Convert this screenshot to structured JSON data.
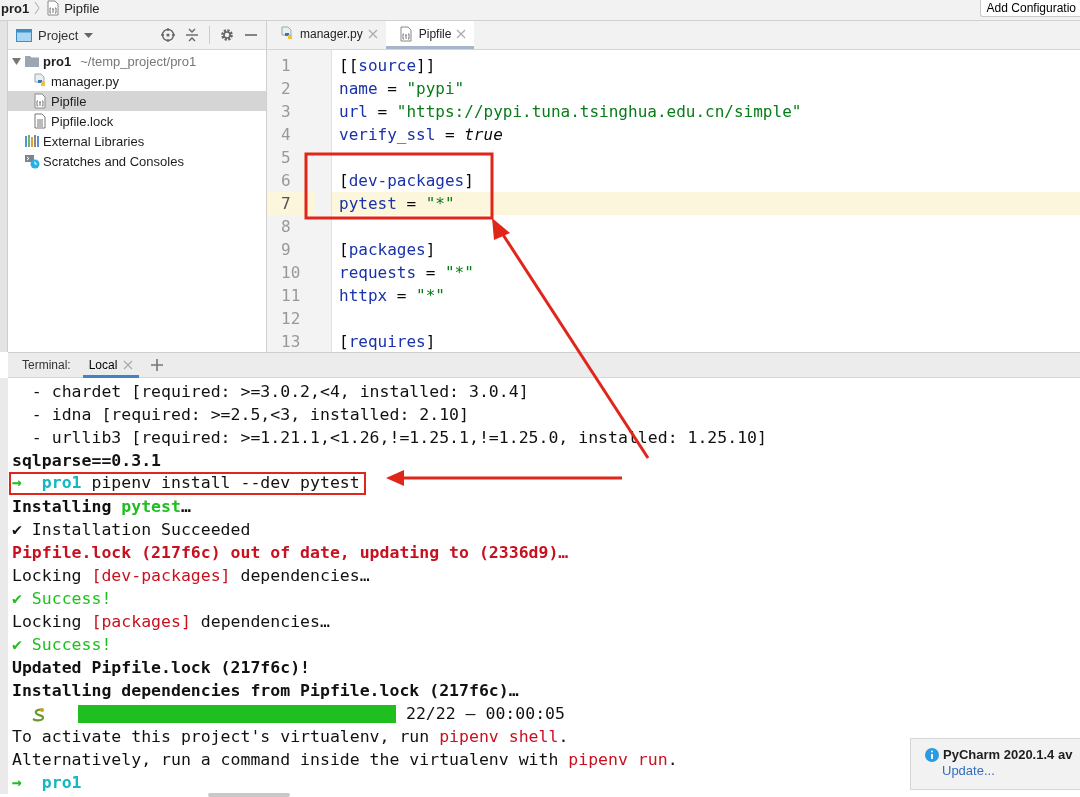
{
  "breadcrumb": [
    {
      "label": "pro1"
    },
    {
      "label": "Pipfile",
      "kind": "pipfile"
    }
  ],
  "run_config_button": "Add Configuratio",
  "project_panel": {
    "title": "Project",
    "tree": [
      {
        "label": "pro1",
        "path": "~/temp_project/pro1",
        "kind": "folder",
        "expanded": true,
        "selected": false,
        "children": [
          {
            "label": "manager.py",
            "kind": "python",
            "selected": false
          },
          {
            "label": "Pipfile",
            "kind": "pipfile",
            "selected": true
          },
          {
            "label": "Pipfile.lock",
            "kind": "text",
            "selected": false
          }
        ]
      },
      {
        "label": "External Libraries",
        "kind": "libraries",
        "selected": false
      },
      {
        "label": "Scratches and Consoles",
        "kind": "scratches",
        "selected": false
      }
    ]
  },
  "editor": {
    "tabs": [
      {
        "label": "manager.py",
        "kind": "python",
        "selected": false
      },
      {
        "label": "Pipfile",
        "kind": "pipfile",
        "selected": true
      }
    ],
    "lines": [
      {
        "number": "1",
        "current": false,
        "tokens": [
          {
            "text": "[[",
            "kind": "punct"
          },
          {
            "text": "source",
            "kind": "name"
          },
          {
            "text": "]]",
            "kind": "punct"
          }
        ]
      },
      {
        "number": "2",
        "current": false,
        "tokens": [
          {
            "text": "name",
            "kind": "name"
          },
          {
            "text": " = ",
            "kind": "punct"
          },
          {
            "text": "\"pypi\"",
            "kind": "string"
          }
        ]
      },
      {
        "number": "3",
        "current": false,
        "tokens": [
          {
            "text": "url",
            "kind": "name"
          },
          {
            "text": " = ",
            "kind": "punct"
          },
          {
            "text": "\"https://pypi.tuna.tsinghua.edu.cn/simple\"",
            "kind": "string"
          }
        ]
      },
      {
        "number": "4",
        "current": false,
        "tokens": [
          {
            "text": "verify_ssl",
            "kind": "name"
          },
          {
            "text": " = ",
            "kind": "punct"
          },
          {
            "text": "true",
            "kind": "keyword"
          }
        ]
      },
      {
        "number": "5",
        "current": false
      },
      {
        "number": "6",
        "current": false,
        "tokens": [
          {
            "text": "[",
            "kind": "punct"
          },
          {
            "text": "dev-packages",
            "kind": "name"
          },
          {
            "text": "]",
            "kind": "punct"
          }
        ]
      },
      {
        "number": "7",
        "current": true,
        "tokens": [
          {
            "text": "pytest",
            "kind": "name"
          },
          {
            "text": " = ",
            "kind": "punct"
          },
          {
            "text": "\"*\"",
            "kind": "string"
          }
        ]
      },
      {
        "number": "8",
        "current": false
      },
      {
        "number": "9",
        "current": false,
        "tokens": [
          {
            "text": "[",
            "kind": "punct"
          },
          {
            "text": "packages",
            "kind": "name"
          },
          {
            "text": "]",
            "kind": "punct"
          }
        ]
      },
      {
        "number": "10",
        "current": false,
        "tokens": [
          {
            "text": "requests",
            "kind": "name"
          },
          {
            "text": " = ",
            "kind": "punct"
          },
          {
            "text": "\"*\"",
            "kind": "string"
          }
        ]
      },
      {
        "number": "11",
        "current": false,
        "tokens": [
          {
            "text": "httpx",
            "kind": "name"
          },
          {
            "text": " = ",
            "kind": "punct"
          },
          {
            "text": "\"*\"",
            "kind": "string"
          }
        ]
      },
      {
        "number": "12",
        "current": false
      },
      {
        "number": "13",
        "current": false,
        "tokens": [
          {
            "text": "[",
            "kind": "punct"
          },
          {
            "text": "requires",
            "kind": "name"
          },
          {
            "text": "]",
            "kind": "punct"
          }
        ]
      }
    ]
  },
  "terminal": {
    "label": "Terminal:",
    "tabs": [
      {
        "label": "Local",
        "selected": true
      }
    ],
    "lines": [
      {
        "kind": "text",
        "framed": false,
        "segs": [
          {
            "text": "  - chardet [required: >=3.0.2,<4, installed: 3.0.4]",
            "kind": "plain"
          }
        ]
      },
      {
        "kind": "text",
        "framed": false,
        "segs": [
          {
            "text": "  - idna [required: >=2.5,<3, installed: 2.10]",
            "kind": "plain"
          }
        ]
      },
      {
        "kind": "text",
        "framed": false,
        "segs": [
          {
            "text": "  - urllib3 [required: >=1.21.1,<1.26,!=1.25.1,!=1.25.0, installed: 1.25.10]",
            "kind": "plain"
          }
        ]
      },
      {
        "kind": "text",
        "framed": false,
        "segs": [
          {
            "text": "sqlparse==0.3.1",
            "kind": "bold"
          }
        ]
      },
      {
        "kind": "text",
        "framed": true,
        "segs": [
          {
            "text": "→",
            "kind": "prompt-arrow"
          },
          {
            "text": "pro1",
            "kind": "prompt-dir"
          },
          {
            "text": " pipenv install --dev pytest",
            "kind": "plain"
          }
        ]
      },
      {
        "kind": "text",
        "framed": false,
        "segs": [
          {
            "text": "Installing ",
            "kind": "bold"
          },
          {
            "text": "pytest",
            "kind": "green-bold"
          },
          {
            "text": "…",
            "kind": "bold"
          }
        ]
      },
      {
        "kind": "text",
        "framed": false,
        "segs": [
          {
            "text": "✔ Installation Succeeded",
            "kind": "plain"
          }
        ]
      },
      {
        "kind": "text",
        "framed": false,
        "segs": [
          {
            "text": "Pipfile.lock (217f6c) out of date, updating to (2336d9)…",
            "kind": "red-bold"
          }
        ]
      },
      {
        "kind": "text",
        "framed": false,
        "segs": [
          {
            "text": "Locking ",
            "kind": "plain"
          },
          {
            "text": "[dev-packages]",
            "kind": "red"
          },
          {
            "text": " dependencies…",
            "kind": "plain"
          }
        ]
      },
      {
        "kind": "text",
        "framed": false,
        "segs": [
          {
            "text": "✔ Success!",
            "kind": "green"
          }
        ]
      },
      {
        "kind": "text",
        "framed": false,
        "segs": [
          {
            "text": "Locking ",
            "kind": "plain"
          },
          {
            "text": "[packages]",
            "kind": "red"
          },
          {
            "text": " dependencies…",
            "kind": "plain"
          }
        ]
      },
      {
        "kind": "text",
        "framed": false,
        "segs": [
          {
            "text": "✔ Success!",
            "kind": "green"
          }
        ]
      },
      {
        "kind": "text",
        "framed": false,
        "segs": [
          {
            "text": "Updated Pipfile.lock (217f6c)!",
            "kind": "bold"
          }
        ]
      },
      {
        "kind": "text",
        "framed": false,
        "segs": [
          {
            "text": "Installing dependencies from Pipfile.lock (217f6c)…",
            "kind": "bold"
          }
        ]
      },
      {
        "kind": "progress",
        "framed": false,
        "level": 1,
        "reading": "22/22 — 00:00:05"
      },
      {
        "kind": "text",
        "framed": false,
        "segs": [
          {
            "text": "To activate this project's virtualenv, run ",
            "kind": "plain"
          },
          {
            "text": "pipenv shell",
            "kind": "red"
          },
          {
            "text": ".",
            "kind": "plain"
          }
        ]
      },
      {
        "kind": "text",
        "framed": false,
        "segs": [
          {
            "text": "Alternatively, run a command inside the virtualenv with ",
            "kind": "plain"
          },
          {
            "text": "pipenv run",
            "kind": "red"
          },
          {
            "text": ".",
            "kind": "plain"
          }
        ]
      },
      {
        "kind": "text",
        "framed": false,
        "segs": [
          {
            "text": "→",
            "kind": "prompt-arrow"
          },
          {
            "text": "pro1",
            "kind": "prompt-dir"
          }
        ]
      }
    ]
  },
  "notification": {
    "title": "PyCharm 2020.1.4 av",
    "link": "Update..."
  }
}
